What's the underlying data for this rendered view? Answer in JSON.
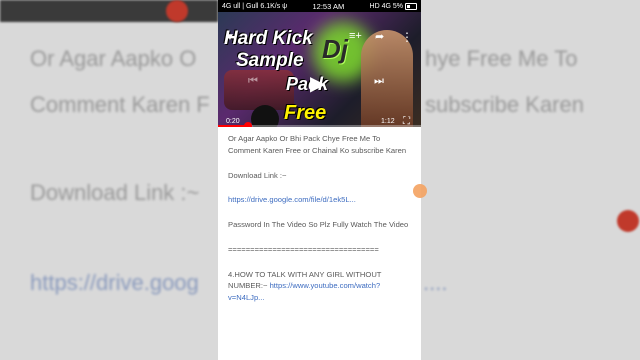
{
  "background": {
    "left_texts": [
      "Or Agar Aapko O",
      "Comment Karen F",
      "Download Link :~",
      "https://drive.goog"
    ],
    "right_texts": [
      "hye Free Me To",
      "subscribe Karen",
      "...."
    ]
  },
  "status": {
    "network": "4G ull | Gull 6.1K/s ψ",
    "time": "12:53 AM",
    "right": "HD 4G 5%"
  },
  "video": {
    "title_lines": [
      "Hard Kick",
      "Dj",
      "Sample",
      "Pack",
      "Free"
    ],
    "time_current": "0:20",
    "time_total": "1:12",
    "progress": 0.15
  },
  "description": {
    "line1": "Or Agar Aapko Or Bhi Pack Chye Free Me To Comment Karen Free or Chainal Ko subscribe Karen",
    "download_label": "Download Link :~",
    "download_url": "https://drive.google.com/file/d/1ek5L...",
    "password_note": "Password In The Video So Plz Fully Watch The Video",
    "divider": "==================================",
    "item4_text": "4.HOW TO TALK WITH ANY GIRL WITHOUT NUMBER:~",
    "item4_link": "https://www.youtube.com/watch?v=N4LJp..."
  },
  "colors": {
    "link": "#3d6cc0",
    "seek": "#ff0000",
    "title_accent": "#fff200"
  }
}
